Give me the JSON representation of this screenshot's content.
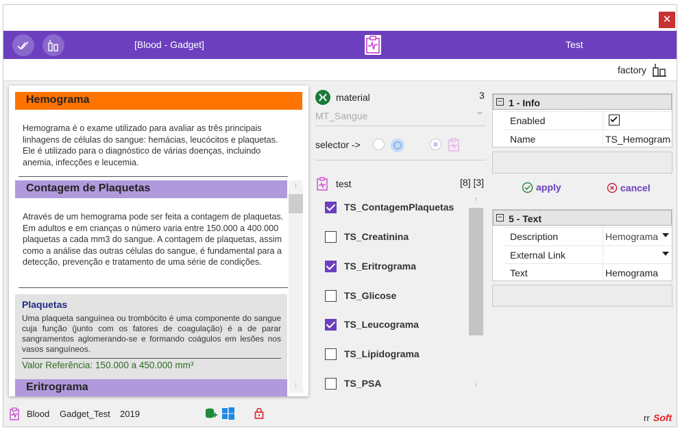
{
  "window": {
    "close_glyph": "✕"
  },
  "header": {
    "title": "[Blood - Gadget]",
    "right_title": "Test",
    "accent": "#6b3fbe"
  },
  "subbar": {
    "factory_label": "factory"
  },
  "left": {
    "sections": [
      {
        "title": "Hemograma",
        "text": "Hemograma é o exame utilizado para avaliar as três principais linhagens de células do sangue: hemácias, leucócitos e plaquetas. Ele é utilizado para o diagnóstico de várias doenças, incluindo anemia, infecções e leucemia."
      },
      {
        "title": "Contagem de Plaquetas",
        "text": "Através de um hemograma pode ser feita a contagem de plaquetas. Em adultos e em crianças o número varia entre 150.000 a 400.000 plaquetas a cada mm3 do sangue. A contagem de plaquetas, assim como a análise das outras células do sangue, é fundamental para a detecção, prevenção e tratamento de uma série de condições."
      },
      {
        "title": "Eritrograma"
      }
    ],
    "info_box": {
      "title": "Plaquetas",
      "text": "Uma plaqueta sanguínea ou trombócito é uma componente do sangue cuja função (junto com os fatores de coagulação) é a de parar sangramentos aglomerando-se e formando coágulos em lesões nos vasos sanguíneos.",
      "reference": "Valor Referência: 150.000 a 450.000 mm³"
    },
    "scroll_up": "↑",
    "scroll_down": "↓"
  },
  "footer": {
    "category": "Blood",
    "gadget": "Gadget_Test",
    "year": "2019",
    "brand_rr": "rr",
    "brand_soft": "Soft"
  },
  "middle": {
    "material_label": "material",
    "material_count": "3",
    "material_value": "MT_Sangue",
    "selector_label": "selector ->",
    "test_label": "test",
    "test_counts": "[8] [3]",
    "tests": [
      {
        "label": "TS_ContagemPlaquetas",
        "checked": true
      },
      {
        "label": "TS_Creatinina",
        "checked": false
      },
      {
        "label": "TS_Eritrograma",
        "checked": true
      },
      {
        "label": "TS_Glicose",
        "checked": false
      },
      {
        "label": "TS_Leucograma",
        "checked": true
      },
      {
        "label": "TS_Lipidograma",
        "checked": false
      },
      {
        "label": "TS_PSA",
        "checked": false
      }
    ],
    "scroll_up": "↑",
    "scroll_down": "↓"
  },
  "right": {
    "info_group": {
      "title": "1 - Info",
      "rows": [
        {
          "key": "Enabled",
          "value": "",
          "checked": true
        },
        {
          "key": "Name",
          "value": "TS_Hemograma"
        }
      ]
    },
    "apply_label": "apply",
    "cancel_label": "cancel",
    "text_group": {
      "title": "5 - Text",
      "rows": [
        {
          "key": "Description",
          "value": "Hemograma"
        },
        {
          "key": "External Link",
          "value": ""
        },
        {
          "key": "Text",
          "value": "Hemograma"
        }
      ]
    }
  }
}
